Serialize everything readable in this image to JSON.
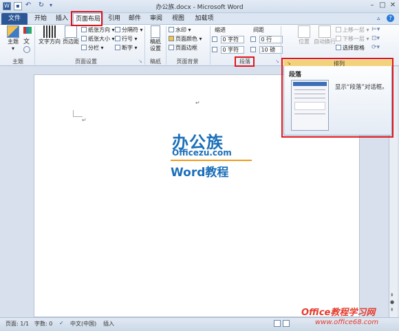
{
  "window": {
    "title": "办公族.docx - Microsoft Word"
  },
  "tabs": [
    "文件",
    "开始",
    "插入",
    "页面布局",
    "引用",
    "邮件",
    "审阅",
    "视图",
    "加载项"
  ],
  "ribbon": {
    "theme": {
      "main_label": "主题",
      "group_label": "主题"
    },
    "page_setup": {
      "text_direction": "文字方向",
      "margins": "页边距",
      "orientation": "纸张方向",
      "size": "纸张大小",
      "columns": "分栏",
      "breaks": "分隔符",
      "line_numbers": "行号",
      "hyphenation": "断字",
      "group_label": "页面设置"
    },
    "draft": {
      "label": "稿纸\n设置",
      "group_label": "稿纸"
    },
    "page_background": {
      "watermark": "水印",
      "page_color": "页面颜色",
      "page_border": "页面边框",
      "group_label": "页面背景"
    },
    "paragraph": {
      "indent_label": "缩进",
      "spacing_label": "间距",
      "indent_left": "0 字符",
      "indent_right": "0 字符",
      "spacing_before": "0 行",
      "spacing_after": "10 磅",
      "group_label": "段落"
    },
    "arrange": {
      "position": "位置",
      "wrap": "自动换行",
      "bring_forward": "上移一层",
      "send_backward": "下移一层",
      "selection_pane": "选择窗格",
      "group_label": "排列"
    }
  },
  "tooltip": {
    "title": "段落",
    "text": "显示“段落”对话框。"
  },
  "logo": {
    "line1": "办公族",
    "line2": "Officezu.com",
    "line3": "Word教程"
  },
  "statusbar": {
    "page": "页面: 1/1",
    "words": "字数: 0",
    "language": "中文(中国)",
    "mode": "插入"
  },
  "watermark": {
    "line1": "Office教程学习网",
    "line2": "www.office68.com"
  },
  "marks": {
    "para": "↵"
  }
}
